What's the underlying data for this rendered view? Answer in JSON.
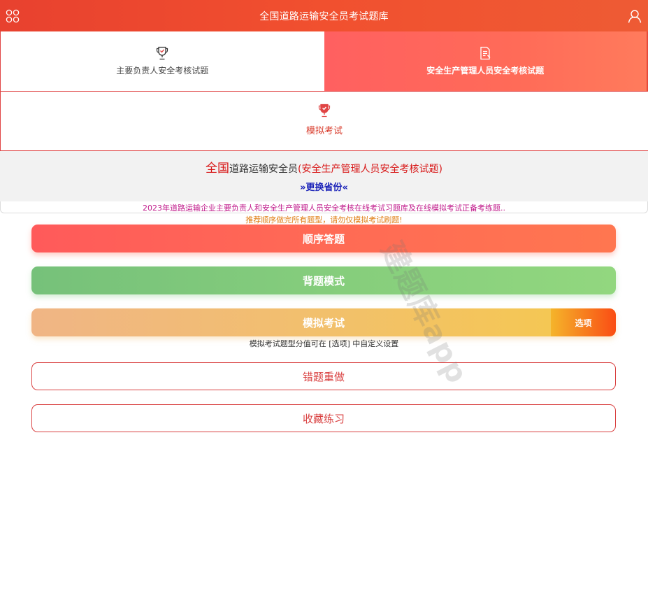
{
  "header": {
    "title": "全国道路运输安全员考试题库",
    "menu_icon": "grid-icon",
    "user_icon": "user-icon"
  },
  "tabs": [
    {
      "label": "主要负责人安全考核试题",
      "icon": "trophy-icon",
      "active": false
    },
    {
      "label": "安全生产管理人员安全考核试题",
      "icon": "document-icon",
      "active": true
    }
  ],
  "mock_tab": {
    "label": "模拟考试",
    "icon": "trophy-icon"
  },
  "banner": {
    "region": "全国",
    "subject": "道路运输安全员",
    "category": "(安全生产管理人员安全考核试题)",
    "switch_label": "»更换省份«"
  },
  "notices": {
    "line1": "2023年道路运输企业主要负责人和安全生产管理人员安全考核在线考试习题库及在线模拟考试正备考练题..",
    "line2": "推荐顺序做完所有题型，请勿仅模拟考试刷题!"
  },
  "buttons": {
    "sequence": "顺序答题",
    "recite": "背题模式",
    "mock": "模拟考试",
    "options": "选项",
    "mock_hint": "模拟考试题型分值可在 [选项] 中自定义设置",
    "wrong": "错题重做",
    "favorites": "收藏练习"
  },
  "watermark": "建题库app",
  "colors": {
    "brand_red": "#e8412f",
    "link_blue": "#1820b8",
    "notice_magenta": "#c11c8c",
    "notice_orange": "#e07f14"
  }
}
